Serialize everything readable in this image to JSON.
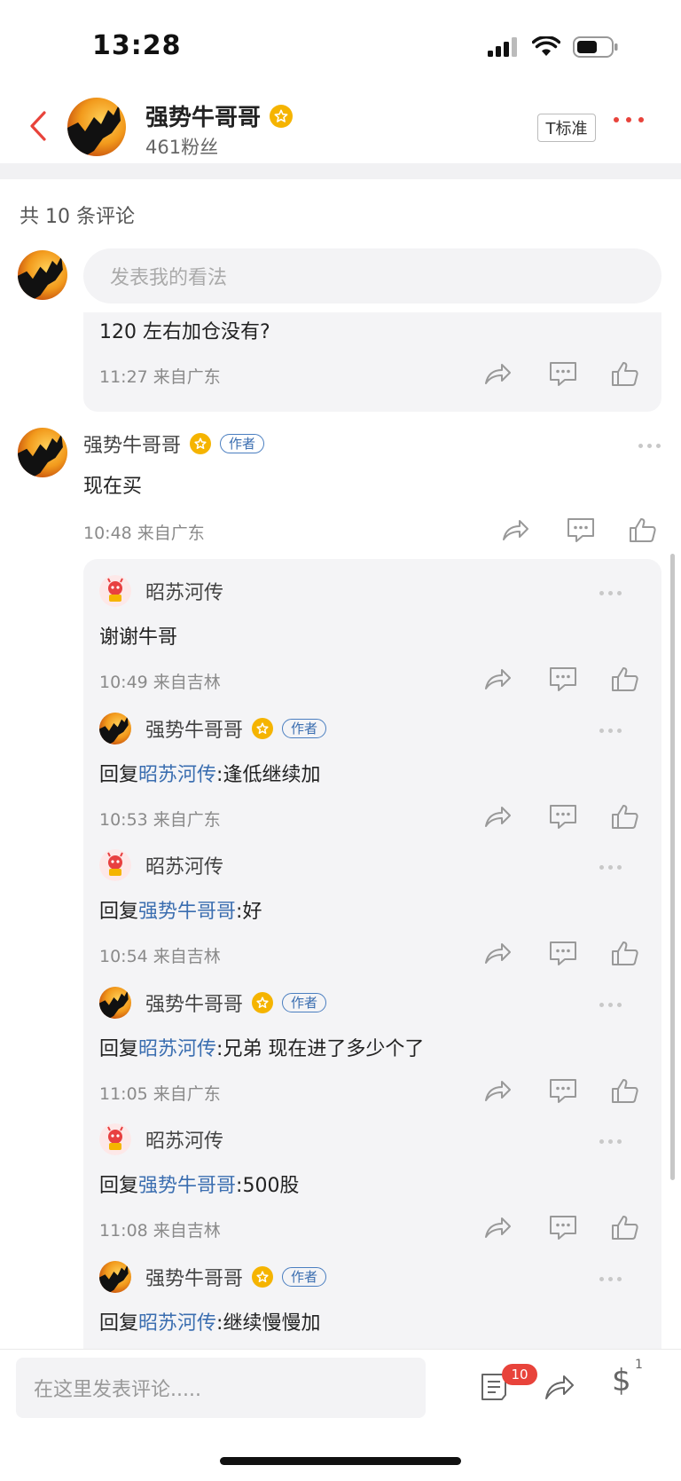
{
  "status": {
    "time": "13:28"
  },
  "header": {
    "name": "强势牛哥哥",
    "fans": "461粉丝",
    "font_label": "T标准"
  },
  "comments_count": "共 10 条评论",
  "compose_placeholder": "发表我的看法",
  "top_reply": {
    "text": "120 左右加仓没有?",
    "meta": "11:27 来自广东"
  },
  "main_comment": {
    "name": "强势牛哥哥",
    "tag": "作者",
    "text": "现在买",
    "meta": "10:48 来自广东"
  },
  "replies": [
    {
      "name": "昭苏河传",
      "author": false,
      "prefix": "",
      "target": "",
      "text": "谢谢牛哥",
      "meta": "10:49 来自吉林"
    },
    {
      "name": "强势牛哥哥",
      "author": true,
      "tag": "作者",
      "prefix": "回复",
      "target": "昭苏河传",
      "text": ":逢低继续加",
      "meta": "10:53 来自广东"
    },
    {
      "name": "昭苏河传",
      "author": false,
      "prefix": "回复",
      "target": "强势牛哥哥",
      "text": ":好",
      "meta": "10:54 来自吉林"
    },
    {
      "name": "强势牛哥哥",
      "author": true,
      "tag": "作者",
      "prefix": "回复",
      "target": "昭苏河传",
      "text": ":兄弟 现在进了多少个了",
      "meta": "11:05 来自广东"
    },
    {
      "name": "昭苏河传",
      "author": false,
      "prefix": "回复",
      "target": "强势牛哥哥",
      "text": ":500股",
      "meta": "11:08 来自吉林"
    },
    {
      "name": "强势牛哥哥",
      "author": true,
      "tag": "作者",
      "prefix": "回复",
      "target": "昭苏河传",
      "text": ":继续慢慢加",
      "meta": ""
    }
  ],
  "bottom": {
    "input_placeholder": "在这里发表评论.....",
    "comment_count_badge": "10",
    "reward_count": "1"
  },
  "colors": {
    "accent_red": "#e8433b",
    "link_blue": "#3b6eb0",
    "vip_gold": "#f5b400"
  }
}
